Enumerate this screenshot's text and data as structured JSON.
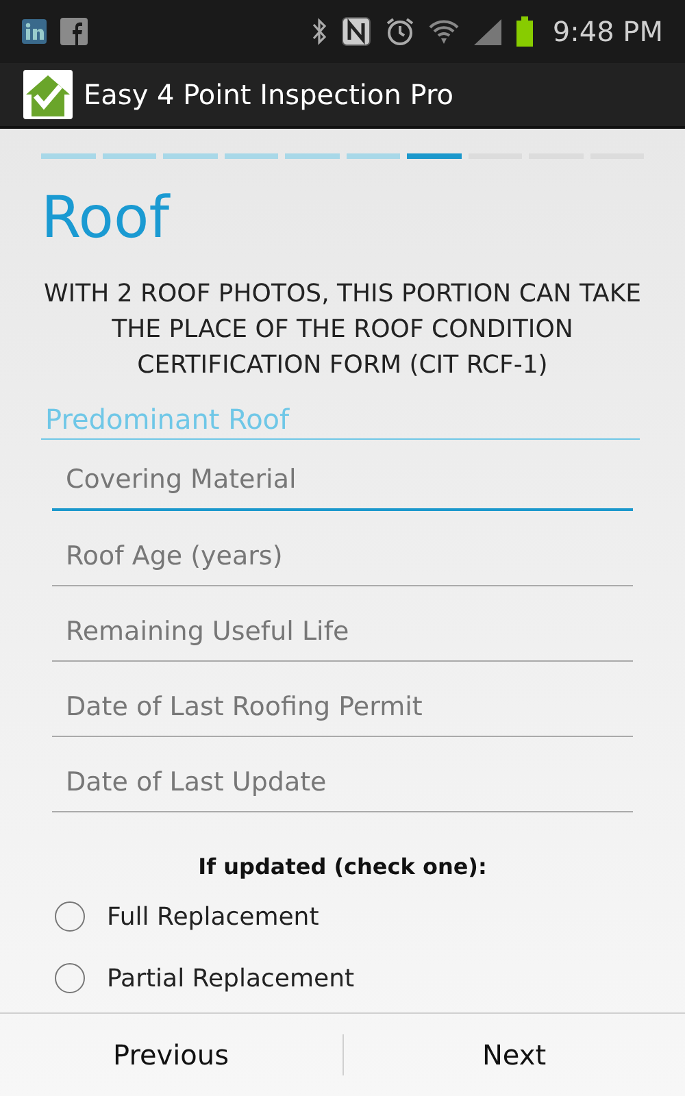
{
  "status_bar": {
    "time": "9:48 PM"
  },
  "app_bar": {
    "title": "Easy 4 Point Inspection Pro"
  },
  "progress_steps": [
    {
      "done": true,
      "selected": false
    },
    {
      "done": true,
      "selected": false
    },
    {
      "done": true,
      "selected": false
    },
    {
      "done": true,
      "selected": false
    },
    {
      "done": true,
      "selected": false
    },
    {
      "done": true,
      "selected": false
    },
    {
      "done": false,
      "selected": true
    },
    {
      "done": false,
      "selected": false
    },
    {
      "done": false,
      "selected": false
    },
    {
      "done": false,
      "selected": false
    }
  ],
  "page_title": "Roof",
  "notice": "WITH 2 ROOF PHOTOS, THIS PORTION CAN TAKE THE PLACE OF THE ROOF CONDITION CERTIFICATION FORM (CIT RCF-1)",
  "section": "Predominant Roof",
  "fields": [
    {
      "placeholder": "Covering Material",
      "focused": true
    },
    {
      "placeholder": "Roof Age (years)",
      "focused": false
    },
    {
      "placeholder": "Remaining Useful Life",
      "focused": false
    },
    {
      "placeholder": "Date of Last Roofing Permit",
      "focused": false
    },
    {
      "placeholder": "Date of Last Update",
      "focused": false
    }
  ],
  "question": "If updated (check one):",
  "options": [
    {
      "label": "Full Replacement",
      "selected": false
    },
    {
      "label": "Partial Replacement",
      "selected": false
    }
  ],
  "buttons": [
    {
      "label": "Previous"
    },
    {
      "label": "Next"
    }
  ]
}
